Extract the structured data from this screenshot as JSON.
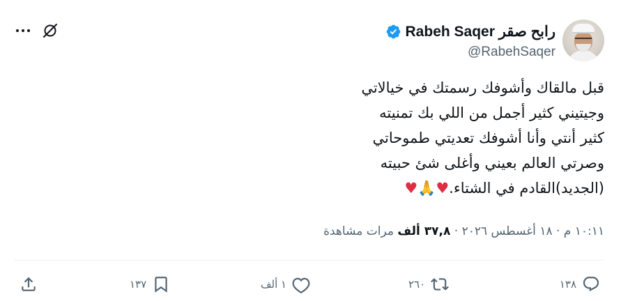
{
  "author": {
    "display_name": "Rabeh Saqer رابح صقر",
    "handle": "@RabehSaqer",
    "verified": true,
    "verified_color": "#1d9bf0"
  },
  "tweet": {
    "lines": [
      "قبل مالقاك وأشوفك رسمتك في خيالاتي",
      "وجيتيني كثير أجمل من اللي بك تمنيته",
      "كثير أنتي وأنا أشوفك تعديتي طموحاتي",
      "وصرتي العالم بعيني وأغلى شئ حبيته"
    ],
    "last_line_text": "(الجديد)القادم في الشتاء.",
    "emoji": {
      "heart": "♥",
      "pray": "🙏"
    }
  },
  "meta": {
    "time": "١٠:١١ م",
    "date": "١٨ أغسطس ٢٠٢٦",
    "views_count": "٣٧,٨ ألف",
    "views_label": "مرات مشاهدة",
    "separator": "·"
  },
  "actions": {
    "replies": "١٣٨",
    "reposts": "٢٦٠",
    "likes": "١ ألف",
    "bookmarks": "١٣٧"
  },
  "icons": {
    "more": "more-icon",
    "grok": "grok-icon",
    "reply": "reply-icon",
    "retweet": "retweet-icon",
    "like": "heart-icon",
    "bookmark": "bookmark-icon",
    "share": "share-icon"
  }
}
